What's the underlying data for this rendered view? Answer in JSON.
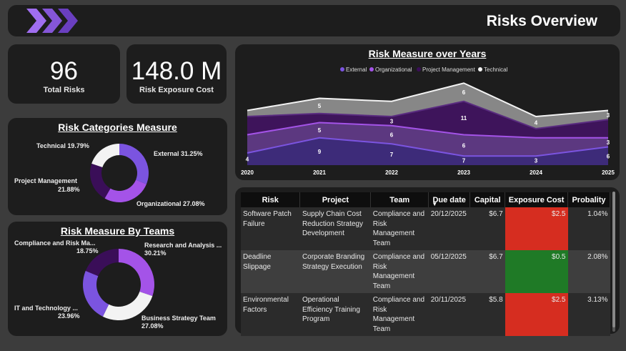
{
  "header": {
    "title": "Risks Overview",
    "logo_icon": "chevrons-right-icon"
  },
  "kpis": {
    "total_risks": {
      "value": "96",
      "label": "Total Risks"
    },
    "exposure": {
      "value": "148.0 M",
      "label": "Risk Exposure Cost"
    }
  },
  "categories": {
    "title": "Risk Categories Measure",
    "labels": [
      "External 31.25%",
      "Organizational 27.08%",
      "Project Management 21.88%",
      "Technical 19.79%"
    ],
    "pm_line1": "Project Management",
    "pm_line2": "21.88%"
  },
  "teams": {
    "title": "Risk Measure By Teams",
    "research_line1": "Research and Analysis ...",
    "research_line2": "30.21%",
    "business_line1": "Business Strategy Team",
    "business_line2": "27.08%",
    "it_line1": "IT and Technology ...",
    "it_line2": "23.96%",
    "compliance_line1": "Compliance and Risk Ma...",
    "compliance_line2": "18.75%"
  },
  "colors": {
    "external": "#7b54e0",
    "organizational": "#a453e8",
    "project_management": "#3a0e58",
    "technical": "#f3f3f3",
    "exposure_high": "#d62d20",
    "exposure_low": "#1f7a26"
  },
  "chart_data": [
    {
      "type": "pie",
      "title": "Risk Categories Measure",
      "categories": [
        "External",
        "Organizational",
        "Project Management",
        "Technical"
      ],
      "values": [
        31.25,
        27.08,
        21.88,
        19.79
      ]
    },
    {
      "type": "pie",
      "title": "Risk Measure By Teams",
      "categories": [
        "Research and Analysis ...",
        "Business Strategy Team",
        "IT and Technology ...",
        "Compliance and Risk Ma..."
      ],
      "values": [
        30.21,
        27.08,
        23.96,
        18.75
      ]
    },
    {
      "type": "area",
      "title": "Risk Measure over Years",
      "x": [
        "2020",
        "2021",
        "2022",
        "2023",
        "2024",
        "2025"
      ],
      "legend": "top",
      "series": [
        {
          "name": "External",
          "values": [
            4,
            9,
            7,
            3,
            3,
            6
          ]
        },
        {
          "name": "Organizational",
          "values": [
            6,
            5,
            6,
            7,
            6,
            3
          ]
        },
        {
          "name": "Project Management",
          "values": [
            6,
            3,
            3,
            11,
            3,
            6
          ]
        },
        {
          "name": "Technical",
          "values": [
            2,
            5,
            5,
            6,
            4,
            3
          ]
        }
      ]
    }
  ],
  "linechart_labels": [
    {
      "text": "4"
    },
    {
      "text": "9"
    },
    {
      "text": "7"
    },
    {
      "text": "7"
    },
    {
      "text": "3"
    },
    {
      "text": "6"
    },
    {
      "text": "5"
    },
    {
      "text": "6"
    },
    {
      "text": "6"
    },
    {
      "text": "3"
    },
    {
      "text": "3"
    },
    {
      "text": "11"
    },
    {
      "text": "5"
    },
    {
      "text": "6"
    },
    {
      "text": "4"
    },
    {
      "text": "3"
    }
  ],
  "table": {
    "headers": [
      "Risk",
      "Project",
      "Team",
      "Due date",
      "Capital",
      "Exposure Cost",
      "Probality"
    ],
    "rows": [
      {
        "risk": "Software Patch Failure",
        "project": "Supply Chain Cost Reduction Strategy Development",
        "team": "Compliance and Risk Management Team",
        "due": "20/12/2025",
        "capital": "$6.7",
        "exposure": "$2.5",
        "prob": "1.04%",
        "level": "high"
      },
      {
        "risk": "Deadline Slippage",
        "project": "Corporate Branding Strategy Execution",
        "team": "Compliance and Risk Management Team",
        "due": "05/12/2025",
        "capital": "$6.7",
        "exposure": "$0.5",
        "prob": "2.08%",
        "level": "low"
      },
      {
        "risk": "Environmental Factors",
        "project": "Operational Efficiency Training Program",
        "team": "Compliance and Risk Management Team",
        "due": "20/11/2025",
        "capital": "$5.8",
        "exposure": "$2.5",
        "prob": "3.13%",
        "level": "high"
      }
    ]
  }
}
